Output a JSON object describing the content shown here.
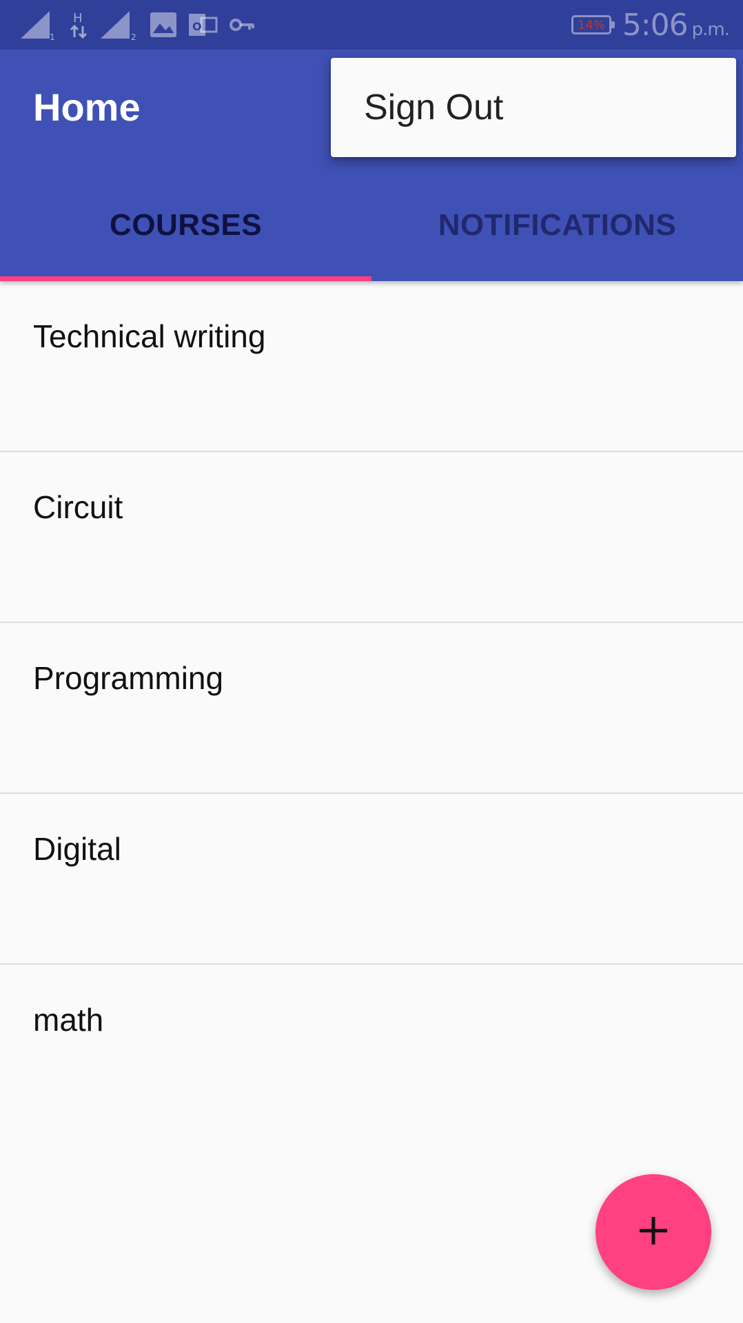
{
  "status_bar": {
    "icons": [
      "signal-sim1-icon",
      "h-data-icon",
      "signal-sim2-icon",
      "gallery-icon",
      "outlook-icon",
      "vpn-key-icon"
    ],
    "battery_level": "14%",
    "time": "5:06",
    "ampm": "p.m."
  },
  "app_bar": {
    "title": "Home"
  },
  "overflow_menu": {
    "items": [
      {
        "label": "Sign Out"
      }
    ]
  },
  "tabs": [
    {
      "label": "COURSES",
      "selected": true
    },
    {
      "label": "NOTIFICATIONS",
      "selected": false
    }
  ],
  "courses": [
    {
      "name": "Technical writing"
    },
    {
      "name": "Circuit"
    },
    {
      "name": "Programming"
    },
    {
      "name": "Digital"
    },
    {
      "name": "math"
    }
  ],
  "fab": {
    "icon": "plus-icon"
  },
  "colors": {
    "primary": "#3f51b5",
    "primary_dark": "#2f3f9a",
    "accent": "#ff4081",
    "background": "#fafafa"
  }
}
